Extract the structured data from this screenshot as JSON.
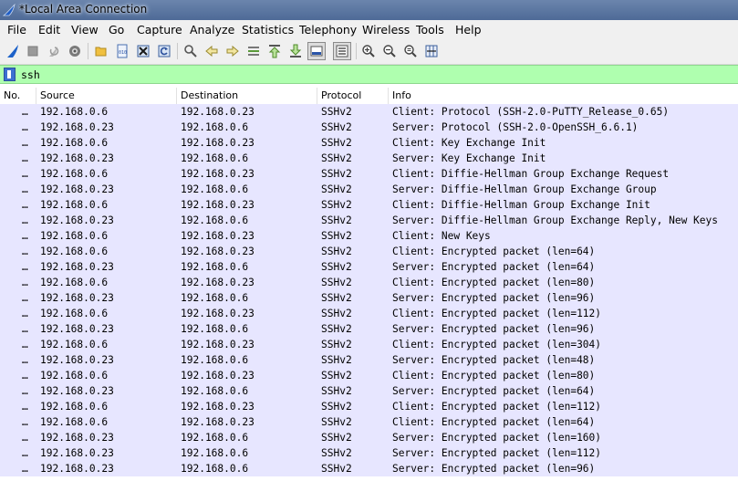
{
  "window": {
    "title": "*Local Area Connection"
  },
  "menu": [
    "File",
    "Edit",
    "View",
    "Go",
    "Capture",
    "Analyze",
    "Statistics",
    "Telephony",
    "Wireless",
    "Tools",
    "Help"
  ],
  "toolbar": {
    "icons": [
      "shark-fin-start-icon",
      "stop-icon",
      "restart-icon",
      "capture-options-icon",
      "open-folder-icon",
      "open-file-icon",
      "close-file-icon",
      "reload-icon",
      "find-icon",
      "back-icon",
      "forward-icon",
      "go-to-packet-icon",
      "first-packet-icon",
      "last-packet-icon",
      "autoscroll-icon",
      "colorize-icon",
      "zoom-in-icon",
      "zoom-out-icon",
      "zoom-normal-icon",
      "resize-columns-icon"
    ]
  },
  "filter": {
    "value": "ssh"
  },
  "columns": {
    "no": "No.",
    "source": "Source",
    "destination": "Destination",
    "protocol": "Protocol",
    "info": "Info"
  },
  "packets": [
    {
      "no": "…",
      "source": "192.168.0.6",
      "destination": "192.168.0.23",
      "protocol": "SSHv2",
      "info": "Client: Protocol (SSH-2.0-PuTTY_Release_0.65)"
    },
    {
      "no": "…",
      "source": "192.168.0.23",
      "destination": "192.168.0.6",
      "protocol": "SSHv2",
      "info": "Server: Protocol (SSH-2.0-OpenSSH_6.6.1)"
    },
    {
      "no": "…",
      "source": "192.168.0.6",
      "destination": "192.168.0.23",
      "protocol": "SSHv2",
      "info": "Client: Key Exchange Init"
    },
    {
      "no": "…",
      "source": "192.168.0.23",
      "destination": "192.168.0.6",
      "protocol": "SSHv2",
      "info": "Server: Key Exchange Init"
    },
    {
      "no": "…",
      "source": "192.168.0.6",
      "destination": "192.168.0.23",
      "protocol": "SSHv2",
      "info": "Client: Diffie-Hellman Group Exchange Request"
    },
    {
      "no": "…",
      "source": "192.168.0.23",
      "destination": "192.168.0.6",
      "protocol": "SSHv2",
      "info": "Server: Diffie-Hellman Group Exchange Group"
    },
    {
      "no": "…",
      "source": "192.168.0.6",
      "destination": "192.168.0.23",
      "protocol": "SSHv2",
      "info": "Client: Diffie-Hellman Group Exchange Init"
    },
    {
      "no": "…",
      "source": "192.168.0.23",
      "destination": "192.168.0.6",
      "protocol": "SSHv2",
      "info": "Server: Diffie-Hellman Group Exchange Reply, New Keys"
    },
    {
      "no": "…",
      "source": "192.168.0.6",
      "destination": "192.168.0.23",
      "protocol": "SSHv2",
      "info": "Client: New Keys"
    },
    {
      "no": "…",
      "source": "192.168.0.6",
      "destination": "192.168.0.23",
      "protocol": "SSHv2",
      "info": "Client: Encrypted packet (len=64)"
    },
    {
      "no": "…",
      "source": "192.168.0.23",
      "destination": "192.168.0.6",
      "protocol": "SSHv2",
      "info": "Server: Encrypted packet (len=64)"
    },
    {
      "no": "…",
      "source": "192.168.0.6",
      "destination": "192.168.0.23",
      "protocol": "SSHv2",
      "info": "Client: Encrypted packet (len=80)"
    },
    {
      "no": "…",
      "source": "192.168.0.23",
      "destination": "192.168.0.6",
      "protocol": "SSHv2",
      "info": "Server: Encrypted packet (len=96)"
    },
    {
      "no": "…",
      "source": "192.168.0.6",
      "destination": "192.168.0.23",
      "protocol": "SSHv2",
      "info": "Client: Encrypted packet (len=112)"
    },
    {
      "no": "…",
      "source": "192.168.0.23",
      "destination": "192.168.0.6",
      "protocol": "SSHv2",
      "info": "Server: Encrypted packet (len=96)"
    },
    {
      "no": "…",
      "source": "192.168.0.6",
      "destination": "192.168.0.23",
      "protocol": "SSHv2",
      "info": "Client: Encrypted packet (len=304)"
    },
    {
      "no": "…",
      "source": "192.168.0.23",
      "destination": "192.168.0.6",
      "protocol": "SSHv2",
      "info": "Server: Encrypted packet (len=48)"
    },
    {
      "no": "…",
      "source": "192.168.0.6",
      "destination": "192.168.0.23",
      "protocol": "SSHv2",
      "info": "Client: Encrypted packet (len=80)"
    },
    {
      "no": "…",
      "source": "192.168.0.23",
      "destination": "192.168.0.6",
      "protocol": "SSHv2",
      "info": "Server: Encrypted packet (len=64)"
    },
    {
      "no": "…",
      "source": "192.168.0.6",
      "destination": "192.168.0.23",
      "protocol": "SSHv2",
      "info": "Client: Encrypted packet (len=112)"
    },
    {
      "no": "…",
      "source": "192.168.0.6",
      "destination": "192.168.0.23",
      "protocol": "SSHv2",
      "info": "Client: Encrypted packet (len=64)"
    },
    {
      "no": "…",
      "source": "192.168.0.23",
      "destination": "192.168.0.6",
      "protocol": "SSHv2",
      "info": "Server: Encrypted packet (len=160)"
    },
    {
      "no": "…",
      "source": "192.168.0.23",
      "destination": "192.168.0.6",
      "protocol": "SSHv2",
      "info": "Server: Encrypted packet (len=112)"
    },
    {
      "no": "…",
      "source": "192.168.0.23",
      "destination": "192.168.0.6",
      "protocol": "SSHv2",
      "info": "Server: Encrypted packet (len=96)"
    }
  ],
  "colors": {
    "row_bg": "#e7e6ff",
    "filter_valid_bg": "#afffaf",
    "start_fin": "#1d62c9"
  }
}
